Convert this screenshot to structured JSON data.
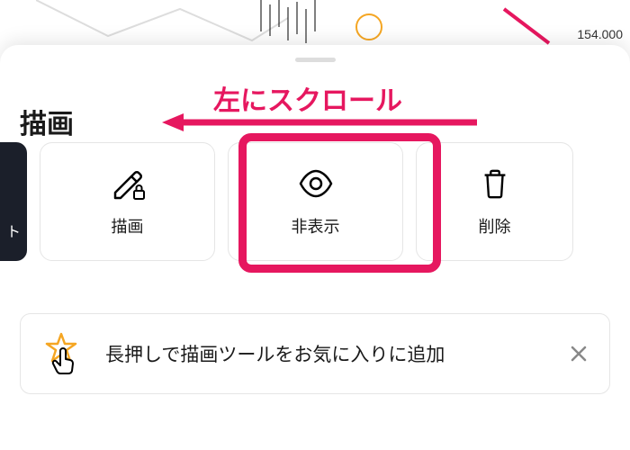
{
  "chart": {
    "price_label": "154.000"
  },
  "sheet": {
    "title": "描画"
  },
  "annotation": {
    "text": "左にスクロール"
  },
  "toolbar": {
    "dark_partial_label": "ト",
    "items": [
      {
        "label": "描画",
        "icon": "pencil-lock-icon"
      },
      {
        "label": "非表示",
        "icon": "eye-icon"
      },
      {
        "label": "削除",
        "icon": "trash-icon"
      }
    ]
  },
  "hint": {
    "text": "長押しで描画ツールをお気に入りに追加"
  }
}
